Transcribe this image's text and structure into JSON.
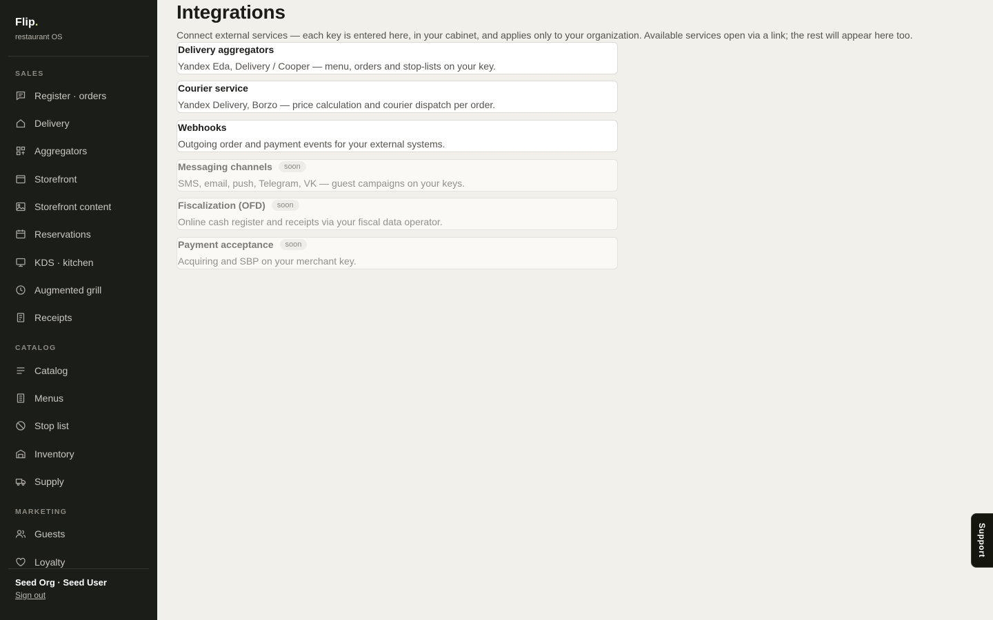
{
  "brand": {
    "name": "Flip",
    "dot": ".",
    "subtitle": "restaurant OS"
  },
  "sidebar": {
    "sections": [
      {
        "label": "SALES",
        "items": [
          {
            "label": "Register · orders",
            "icon": "receipt-chat-icon"
          },
          {
            "label": "Delivery",
            "icon": "house-icon"
          },
          {
            "label": "Aggregators",
            "icon": "grid-icon"
          },
          {
            "label": "Storefront",
            "icon": "browser-window-icon"
          },
          {
            "label": "Storefront content",
            "icon": "image-icon"
          },
          {
            "label": "Reservations",
            "icon": "calendar-icon"
          },
          {
            "label": "KDS · kitchen",
            "icon": "monitor-icon"
          },
          {
            "label": "Augmented grill",
            "icon": "clock-icon"
          },
          {
            "label": "Receipts",
            "icon": "receipt-icon"
          }
        ]
      },
      {
        "label": "CATALOG",
        "items": [
          {
            "label": "Catalog",
            "icon": "list-icon"
          },
          {
            "label": "Menus",
            "icon": "menu-card-icon"
          },
          {
            "label": "Stop list",
            "icon": "ban-icon"
          },
          {
            "label": "Inventory",
            "icon": "warehouse-icon"
          },
          {
            "label": "Supply",
            "icon": "truck-icon"
          }
        ]
      },
      {
        "label": "MARKETING",
        "items": [
          {
            "label": "Guests",
            "icon": "users-icon"
          },
          {
            "label": "Loyalty",
            "icon": "heart-icon"
          }
        ]
      }
    ],
    "footer": {
      "org": "Seed Org · Seed User",
      "signout": "Sign out"
    }
  },
  "main": {
    "title": "Integrations",
    "description": "Connect external services — each key is entered here, in your cabinet, and applies only to your organization. Available services open via a link; the rest will appear here too.",
    "cards": [
      {
        "title": "Delivery aggregators",
        "desc": "Yandex Eda, Delivery / Cooper — menu, orders and stop-lists on your key.",
        "badge": ""
      },
      {
        "title": "Courier service",
        "desc": "Yandex Delivery, Borzo — price calculation and courier dispatch per order.",
        "badge": ""
      },
      {
        "title": "Webhooks",
        "desc": "Outgoing order and payment events for your external systems.",
        "badge": ""
      },
      {
        "title": "Messaging channels",
        "desc": "SMS, email, push, Telegram, VK — guest campaigns on your keys.",
        "badge": "soon"
      },
      {
        "title": "Fiscalization (OFD)",
        "desc": "Online cash register and receipts via your fiscal data operator.",
        "badge": "soon"
      },
      {
        "title": "Payment acceptance",
        "desc": "Acquiring and SBP on your merchant key.",
        "badge": "soon"
      }
    ]
  },
  "support": {
    "label": "Support"
  },
  "colors": {
    "sidebar_bg": "#1b1d18",
    "page_bg": "#f2f0eb",
    "brand_dot": "#d7e46a"
  }
}
